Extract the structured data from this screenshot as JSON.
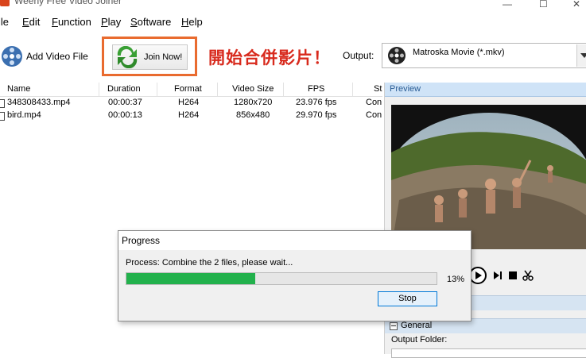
{
  "window": {
    "title": "Weeny Free Video Joiner"
  },
  "menu": [
    {
      "label": "File",
      "u": "F",
      "rest": "ile"
    },
    {
      "label": "Edit",
      "u": "E",
      "rest": "dit"
    },
    {
      "label": "Function",
      "u": "F",
      "rest": "unction"
    },
    {
      "label": "Play",
      "u": "P",
      "rest": "lay"
    },
    {
      "label": "Software",
      "u": "S",
      "rest": "oftware"
    },
    {
      "label": "Help",
      "u": "H",
      "rest": "elp"
    }
  ],
  "toolbar": {
    "add_label": "Add Video File",
    "join_label": "Join Now!",
    "banner": "開始合併影片！",
    "output_label": "Output:",
    "output_value": "Matroska Movie (*.mkv)"
  },
  "filelist": {
    "columns": [
      "Name",
      "Duration",
      "Format",
      "Video Size",
      "FPS",
      "St"
    ],
    "rows": [
      {
        "name": "348308433.mp4",
        "duration": "00:00:37",
        "format": "H264",
        "size": "1280x720",
        "fps": "23.976 fps",
        "status": "Con"
      },
      {
        "name": "bird.mp4",
        "duration": "00:00:13",
        "format": "H264",
        "size": "856x480",
        "fps": "29.970 fps",
        "status": "Con"
      }
    ]
  },
  "preview": {
    "header": "Preview",
    "general": "General",
    "output_folder": "Output Folder:"
  },
  "dialog": {
    "title": "Progress",
    "process_text": "Process: Combine the 2 files, please wait...",
    "percent": "13%",
    "progress": 0.13,
    "stop_label": "Stop"
  },
  "colors": {
    "progress": "#22b14c",
    "highlight": "#e96b2f",
    "banner": "#d82a1d"
  }
}
